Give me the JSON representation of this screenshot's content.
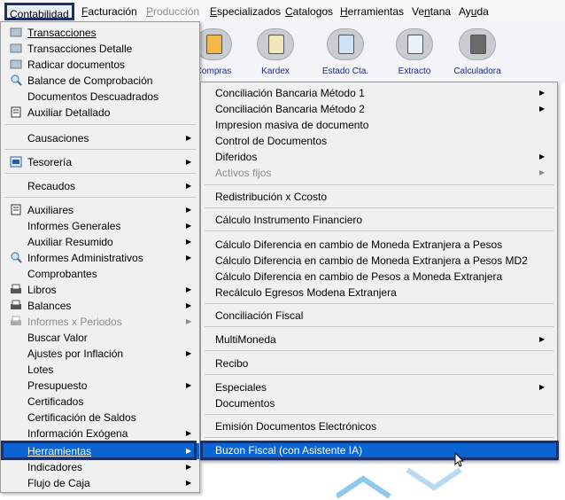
{
  "menubar": {
    "items": [
      {
        "label": "Contabilidad",
        "u": "C",
        "rest": "ontabilidad"
      },
      {
        "label": "Facturación",
        "u": "F",
        "rest": "acturación"
      },
      {
        "label": "Producción",
        "u": "P",
        "rest": "roducción"
      },
      {
        "label": "Especializados",
        "u": "E",
        "rest": "specializados"
      },
      {
        "label": "Catalogos",
        "u": "C",
        "rest": "atalogos"
      },
      {
        "label": "Herramientas",
        "u": "H",
        "rest": "erramientas"
      },
      {
        "label": "Ventana",
        "pre": "Ve",
        "u": "n",
        "rest": "tana"
      },
      {
        "label": "Ayuda",
        "pre": "Ay",
        "u": "u",
        "rest": "da"
      }
    ]
  },
  "toolbar": {
    "items": [
      {
        "label": "Compras",
        "icon": "truck-icon"
      },
      {
        "label": "Kardex",
        "icon": "kardex-icon"
      },
      {
        "label": "Estado Cta.",
        "icon": "statement-icon"
      },
      {
        "label": "Extracto",
        "icon": "extract-icon"
      },
      {
        "label": "Calculadora",
        "icon": "calculator-icon"
      }
    ]
  },
  "main_menu": {
    "items": [
      {
        "label": "Transacciones"
      },
      {
        "label": "Transacciones Detalle"
      },
      {
        "label": "Radicar documentos"
      },
      {
        "label": "Balance de Comprobación"
      },
      {
        "label": "Documentos Descuadrados"
      },
      {
        "label": "Auxiliar Detallado"
      },
      {
        "label": "Causaciones"
      },
      {
        "label": "Tesorería"
      },
      {
        "label": "Recaudos"
      },
      {
        "label": "Auxiliares"
      },
      {
        "label": "Informes Generales"
      },
      {
        "label": "Auxiliar Resumido"
      },
      {
        "label": "Informes Administrativos"
      },
      {
        "label": "Comprobantes"
      },
      {
        "label": "Libros"
      },
      {
        "label": "Balances"
      },
      {
        "label": "Informes x Periodos"
      },
      {
        "label": "Buscar Valor"
      },
      {
        "label": "Ajustes por Inflación"
      },
      {
        "label": "Lotes"
      },
      {
        "label": "Presupuesto"
      },
      {
        "label": "Certificados"
      },
      {
        "label": "Certificación de Saldos"
      },
      {
        "label": "Información Exógena"
      },
      {
        "label": "Herramientas"
      },
      {
        "label": "Indicadores"
      },
      {
        "label": "Flujo de Caja"
      }
    ]
  },
  "submenu": {
    "items": [
      {
        "label": "Conciliación Bancaria  Método 1"
      },
      {
        "label": "Conciliación Bancaria Método 2"
      },
      {
        "label": "Impresion masiva de documento"
      },
      {
        "label": "Control de Documentos"
      },
      {
        "label": "Diferidos"
      },
      {
        "label": "Activos fijos"
      },
      {
        "label": "Redistribución x Ccosto"
      },
      {
        "label": "Cálculo Instrumento Financiero"
      },
      {
        "label": "Cálculo Diferencia en cambio de Moneda Extranjera a Pesos"
      },
      {
        "label": "Cálculo Diferencia en cambio de Moneda Extranjera a Pesos MD2"
      },
      {
        "label": "Cálculo Diferencia en cambio de Pesos a Moneda Extranjera"
      },
      {
        "label": "Recálculo Egresos Modena Extranjera"
      },
      {
        "label": "Conciliación Fiscal"
      },
      {
        "label": "MultiMoneda"
      },
      {
        "label": "Recibo"
      },
      {
        "label": "Especiales"
      },
      {
        "label": "Documentos"
      },
      {
        "label": "Emisión Documentos Electrónicos"
      },
      {
        "label": "Buzon Fiscal (con Asistente IA)"
      }
    ]
  },
  "colors": {
    "selection": "#0a64d2",
    "highlight_border": "#1f2f6b",
    "disabled": "#8c8c8c",
    "menu_bg": "#f0f0f0"
  },
  "arrow_glyph": "▶"
}
